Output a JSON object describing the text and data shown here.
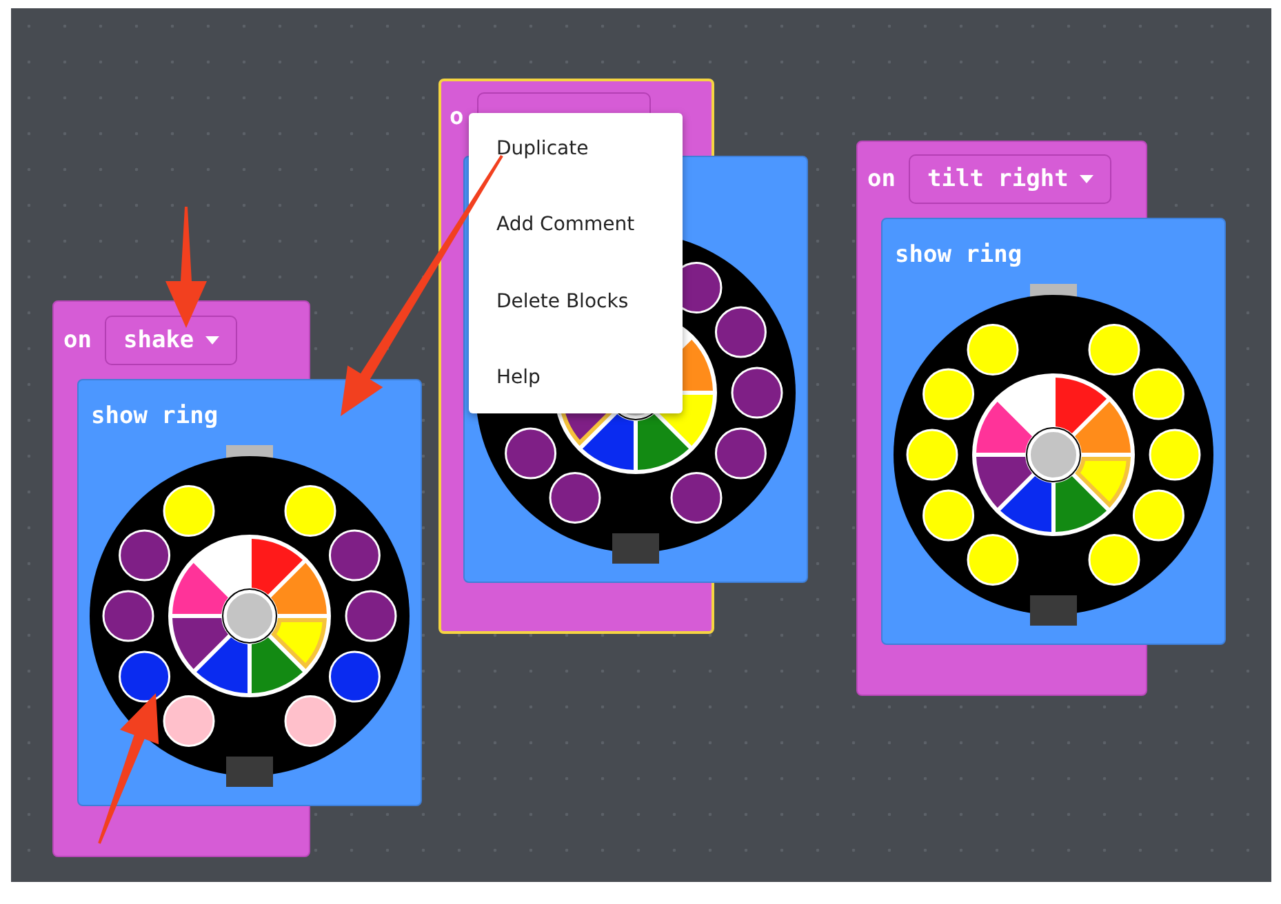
{
  "blocks": [
    {
      "label": "on",
      "event": "shake",
      "selected": false,
      "body": {
        "label": "show ring",
        "leds": [
          {
            "color": "#ffff00"
          },
          {
            "color": "#7f1f86"
          },
          {
            "color": "#7f1f86"
          },
          {
            "color": "#0a2bf0"
          },
          {
            "color": "#ffc0cb"
          },
          {
            "color": "#ffc0cb"
          },
          {
            "color": "#0a2bf0"
          },
          {
            "color": "#7f1f86"
          },
          {
            "color": "#7f1f86"
          },
          {
            "color": "#ffff00"
          }
        ],
        "palette": [
          {
            "color": "#ff8c1a",
            "selected": false
          },
          {
            "color": "#ffff00",
            "selected": true
          },
          {
            "color": "#138a13",
            "selected": false
          },
          {
            "color": "#0a2bf0",
            "selected": false
          },
          {
            "color": "#7f1f86",
            "selected": false
          },
          {
            "color": "#ff3399",
            "selected": false
          },
          {
            "color": "#ffffff",
            "selected": false
          },
          {
            "color": "#ff1a1a",
            "selected": false
          }
        ]
      }
    },
    {
      "label": "o",
      "selected": true,
      "body": {
        "leds": [
          {
            "color": "#7f1f86"
          },
          {
            "color": "#7f1f86"
          },
          {
            "color": "#7f1f86"
          },
          {
            "color": "#7f1f86"
          },
          {
            "color": "#7f1f86"
          },
          {
            "color": "#7f1f86"
          },
          {
            "color": "#7f1f86"
          }
        ],
        "palette": [
          {
            "color": "#ff8c1a",
            "selected": false
          },
          {
            "color": "#ffff00",
            "selected": false
          },
          {
            "color": "#138a13",
            "selected": false
          },
          {
            "color": "#0a2bf0",
            "selected": false
          },
          {
            "color": "#7f1f86",
            "selected": true
          }
        ]
      }
    },
    {
      "label": "on",
      "event": "tilt right",
      "selected": false,
      "body": {
        "label": "show ring",
        "leds": [
          {
            "color": "#ffff00"
          },
          {
            "color": "#ffff00"
          },
          {
            "color": "#ffff00"
          },
          {
            "color": "#ffff00"
          },
          {
            "color": "#ffff00"
          },
          {
            "color": "#ffff00"
          },
          {
            "color": "#ffff00"
          },
          {
            "color": "#ffff00"
          },
          {
            "color": "#ffff00"
          },
          {
            "color": "#ffff00"
          }
        ],
        "palette": [
          {
            "color": "#ff8c1a",
            "selected": false
          },
          {
            "color": "#ffff00",
            "selected": true
          },
          {
            "color": "#138a13",
            "selected": false
          },
          {
            "color": "#0a2bf0",
            "selected": false
          },
          {
            "color": "#7f1f86",
            "selected": false
          },
          {
            "color": "#ff3399",
            "selected": false
          },
          {
            "color": "#ffffff",
            "selected": false
          },
          {
            "color": "#ff1a1a",
            "selected": false
          }
        ]
      }
    }
  ],
  "context_menu": {
    "items": [
      "Duplicate",
      "Add Comment",
      "Delete Blocks",
      "Help"
    ]
  }
}
